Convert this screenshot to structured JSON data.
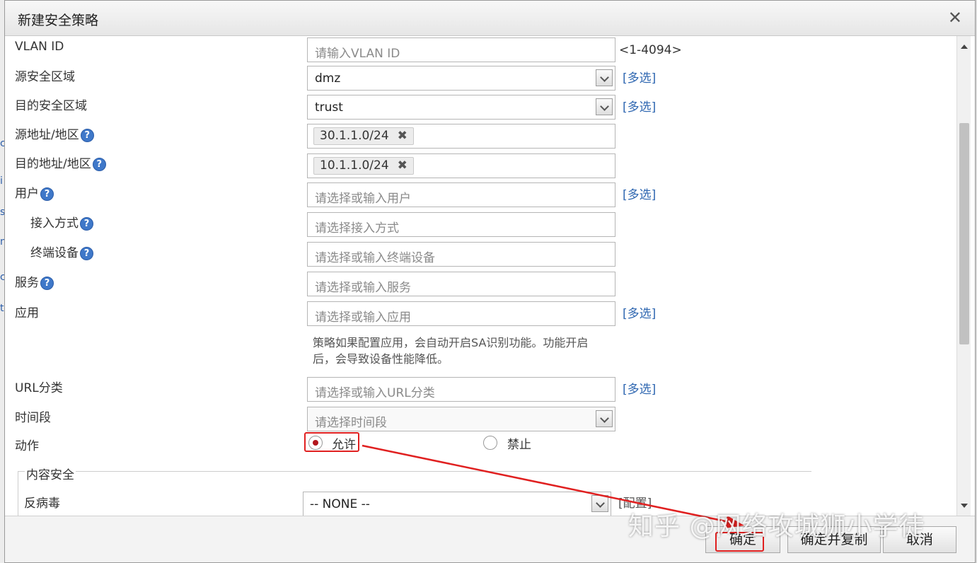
{
  "dialog": {
    "title": "新建安全策略"
  },
  "background_strip": [
    "c",
    "i",
    "s",
    "n",
    "c",
    "t"
  ],
  "form": {
    "vlan": {
      "label": "VLAN ID",
      "placeholder": "请输入VLAN ID",
      "hint": "<1-4094>"
    },
    "src_zone": {
      "label": "源安全区域",
      "value": "dmz",
      "multi": "[多选]"
    },
    "dst_zone": {
      "label": "目的安全区域",
      "value": "trust",
      "multi": "[多选]"
    },
    "src_addr": {
      "label": "源地址/地区",
      "tag": "30.1.1.0/24",
      "tag_remove": "✖"
    },
    "dst_addr": {
      "label": "目的地址/地区",
      "tag": "10.1.1.0/24",
      "tag_remove": "✖"
    },
    "user": {
      "label": "用户",
      "placeholder": "请选择或输入用户",
      "multi": "[多选]"
    },
    "access": {
      "label": "接入方式",
      "placeholder": "请选择接入方式"
    },
    "terminal": {
      "label": "终端设备",
      "placeholder": "请选择或输入终端设备"
    },
    "service": {
      "label": "服务",
      "placeholder": "请选择或输入服务"
    },
    "app": {
      "label": "应用",
      "placeholder": "请选择或输入应用",
      "multi": "[多选]",
      "note_line1": "策略如果配置应用，会自动开启SA识别功能。功能开启",
      "note_line2": "后，会导致设备性能降低。"
    },
    "url": {
      "label": "URL分类",
      "placeholder": "请选择或输入URL分类",
      "multi": "[多选]"
    },
    "time": {
      "label": "时间段",
      "placeholder": "请选择时间段"
    },
    "action": {
      "label": "动作",
      "allow": "允许",
      "deny": "禁止",
      "selected": "允许"
    },
    "content_security": {
      "legend": "内容安全"
    },
    "antivirus": {
      "label": "反病毒",
      "value": "-- NONE --",
      "config": "[配置]"
    }
  },
  "help_glyph": "?",
  "footer": {
    "ok": "确定",
    "ok_copy": "确定并复制",
    "cancel": "取消"
  },
  "watermark": "知乎 @网络攻城狮小学徒",
  "colors": {
    "accent_link": "#2f67b1",
    "annotation_red": "#e02020",
    "radio_checked": "#b3161c"
  }
}
